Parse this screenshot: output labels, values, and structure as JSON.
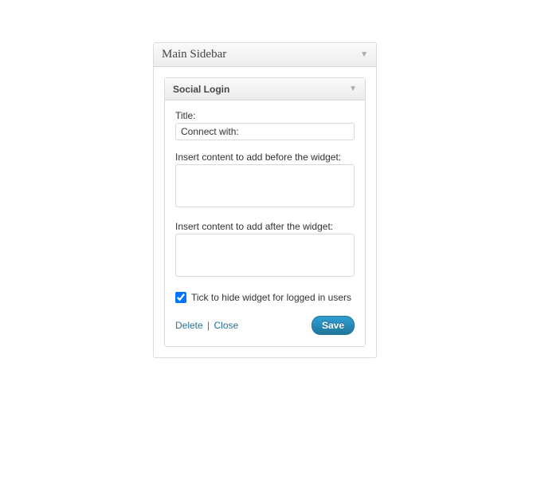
{
  "sidebar": {
    "title": "Main Sidebar"
  },
  "widget": {
    "title": "Social Login",
    "fields": {
      "title_label": "Title:",
      "title_value": "Connect with:",
      "before_label": "Insert content to add before the widget:",
      "before_value": "",
      "after_label": "Insert content to add after the widget:",
      "after_value": "",
      "hide_label": "Tick to hide widget for logged in users",
      "hide_checked": true
    },
    "actions": {
      "delete": "Delete",
      "close": "Close",
      "save": "Save",
      "separator": "|"
    }
  }
}
